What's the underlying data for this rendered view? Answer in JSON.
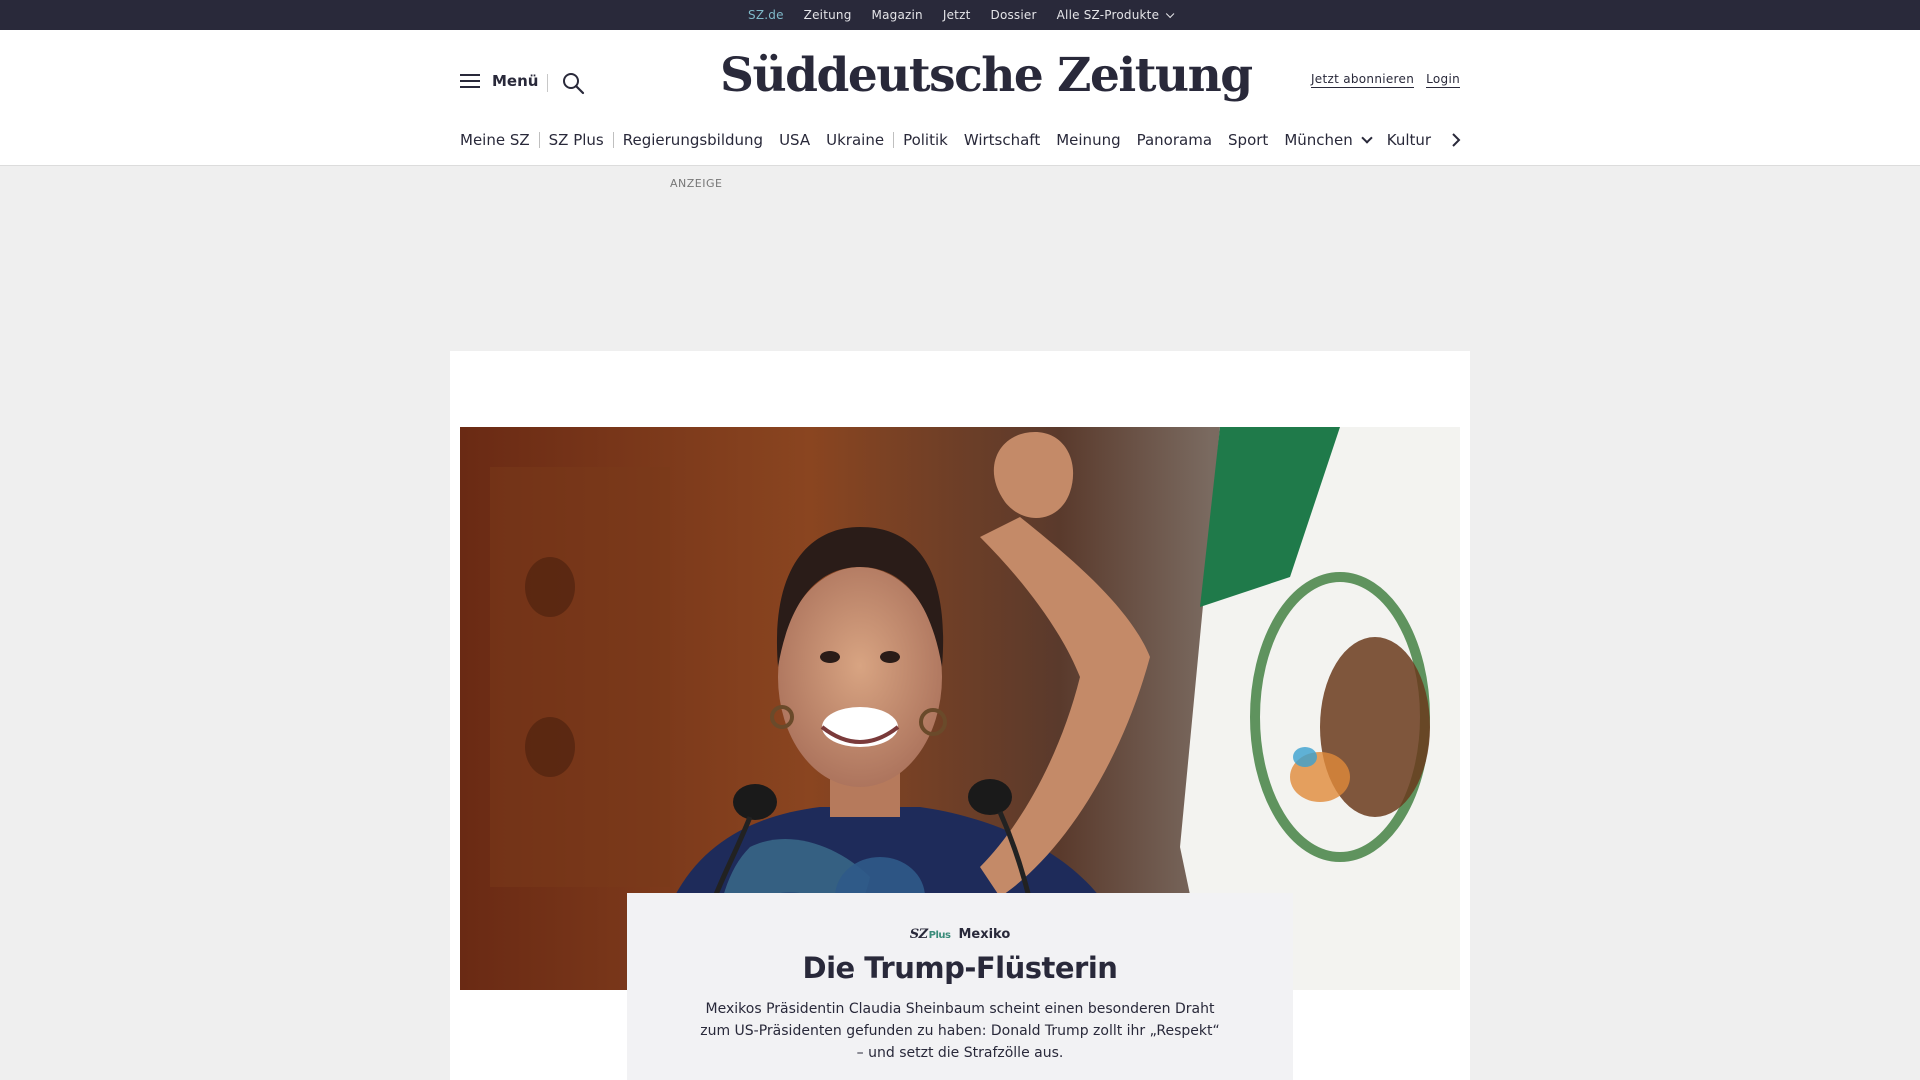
{
  "topbar": {
    "links": [
      "SZ.de",
      "Zeitung",
      "Magazin",
      "Jetzt",
      "Dossier",
      "Alle SZ-Produkte"
    ],
    "active": "SZ.de"
  },
  "header": {
    "menu_label": "Menü",
    "logo": "Süddeutsche Zeitung",
    "subscribe_label": "Jetzt abonnieren",
    "login_label": "Login"
  },
  "nav": {
    "items": [
      "Meine SZ",
      "SZ Plus",
      "Regierungsbildung",
      "USA",
      "Ukraine",
      "Politik",
      "Wirtschaft",
      "Meinung",
      "Panorama",
      "Sport",
      "München",
      "Kultur"
    ]
  },
  "ad": {
    "label": "ANZEIGE"
  },
  "teaser": {
    "brand": "SZ",
    "brand_suffix": "Plus",
    "kicker": "Mexiko",
    "headline": "Die Trump-Flüsterin",
    "summary": "Mexikos Präsidentin Claudia Sheinbaum scheint einen besonderen Draht zum US-Präsidenten gefunden zu haben: Donald Trump zollt ihr „Respekt“ – und setzt die Strafzölle aus."
  },
  "colors": {
    "topbar_bg": "#29293a",
    "active_link": "#7fb9c9",
    "plus_green": "#3a8c7a",
    "page_bg": "#efefef"
  }
}
